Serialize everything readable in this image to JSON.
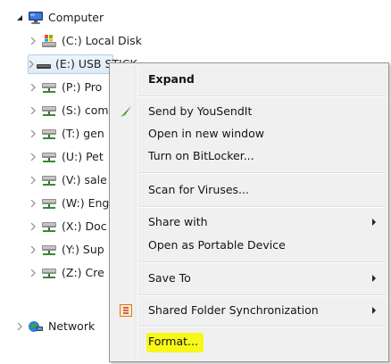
{
  "tree": {
    "root": {
      "label": "Computer",
      "icon": "computer-icon"
    },
    "items": [
      {
        "label": "(C:) Local Disk",
        "icon": "local-disk-icon"
      },
      {
        "label": "(E:) USB STICK",
        "icon": "usb-drive-icon",
        "selected": true
      },
      {
        "label": "(P:) Pro",
        "icon": "network-drive-icon"
      },
      {
        "label": "(S:) com",
        "icon": "network-drive-icon"
      },
      {
        "label": "(T:) gen",
        "icon": "network-drive-icon"
      },
      {
        "label": "(U:) Pet",
        "icon": "network-drive-icon"
      },
      {
        "label": "(V:) sale",
        "icon": "network-drive-icon"
      },
      {
        "label": "(W:) Eng",
        "icon": "network-drive-icon"
      },
      {
        "label": "(X:) Doc",
        "icon": "network-drive-icon"
      },
      {
        "label": "(Y:) Sup",
        "icon": "network-drive-icon"
      },
      {
        "label": "(Z:) Cre",
        "icon": "network-drive-icon"
      }
    ],
    "network": {
      "label": "Network",
      "icon": "network-icon"
    }
  },
  "context_menu": {
    "expand": "Expand",
    "send_by_yousendit": "Send by YouSendIt",
    "open_new_window": "Open in new window",
    "turn_on_bitlocker": "Turn on BitLocker...",
    "scan_for_viruses": "Scan for Viruses...",
    "share_with": "Share with",
    "open_as_portable": "Open as Portable Device",
    "save_to": "Save To",
    "shared_folder_sync": "Shared Folder Synchronization",
    "format": "Format..."
  },
  "colors": {
    "highlight": "#f7f71a",
    "menu_background": "#f0f0f0",
    "selection_border": "#b7cde8"
  }
}
